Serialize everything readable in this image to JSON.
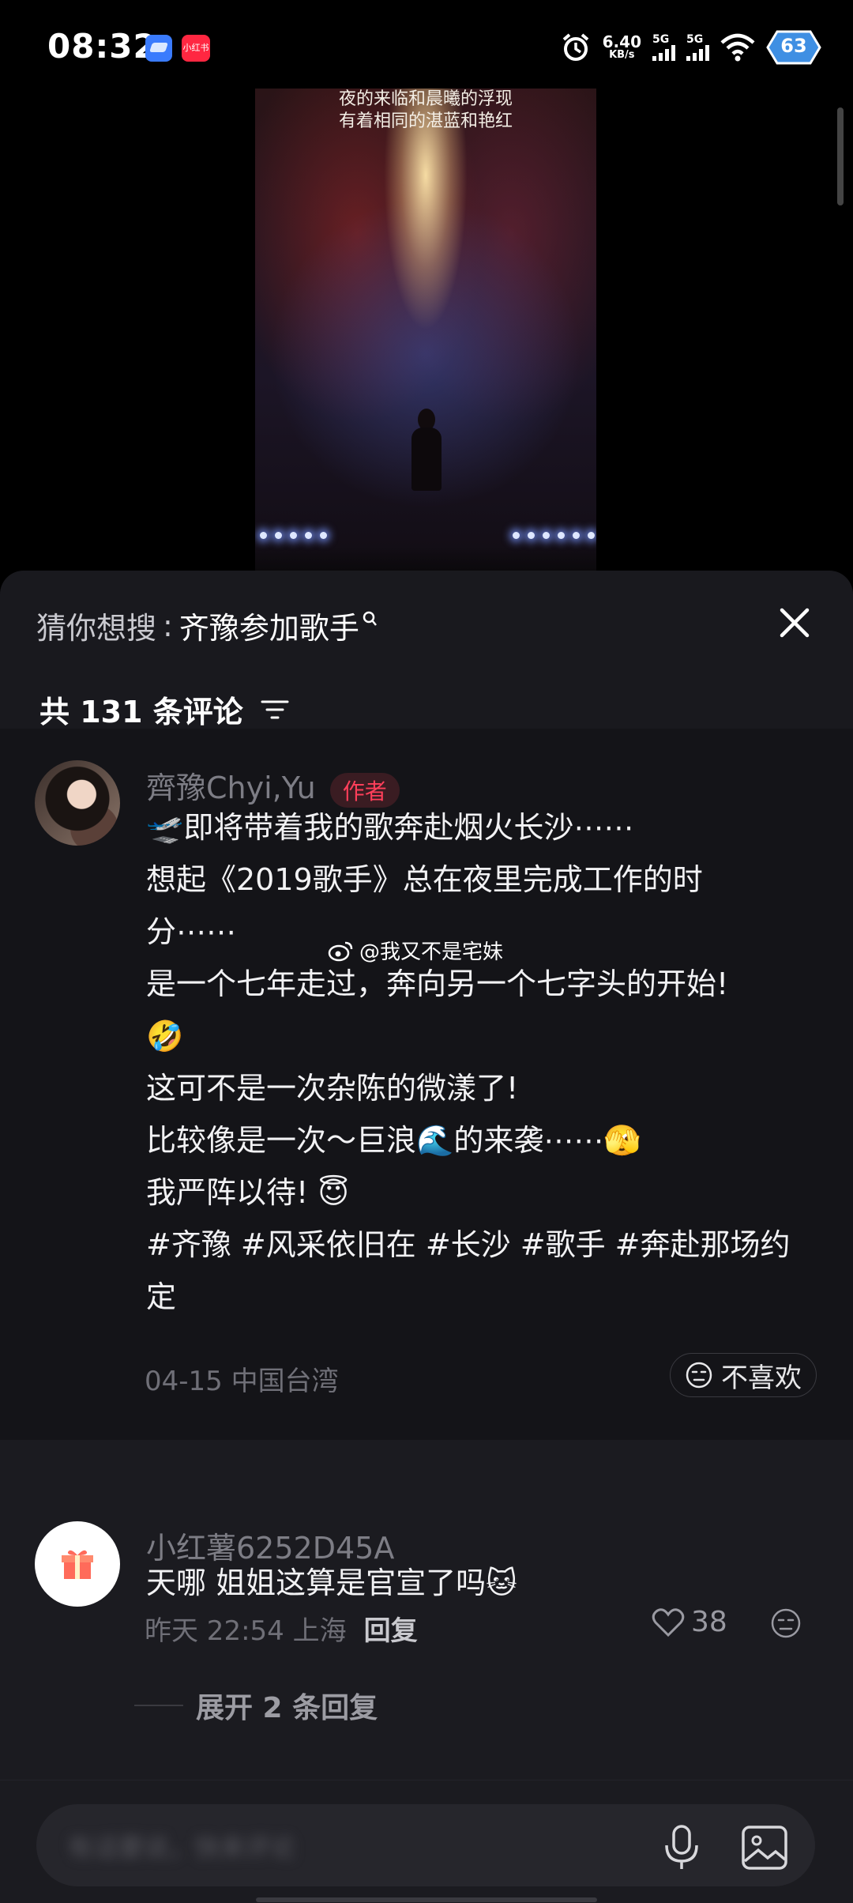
{
  "status_bar": {
    "time": "08:32",
    "app_badge": "小红书",
    "net_speed": "6.40",
    "net_unit": "KB/s",
    "signal1": "5G",
    "signal2": "5G",
    "battery": "63"
  },
  "video": {
    "caption_line1": "夜的来临和晨曦的浮现",
    "caption_line2": "有着相同的湛蓝和艳红"
  },
  "search_suggestion": {
    "prefix": "猜你想搜",
    "separator": ":",
    "query": "齐豫参加歌手"
  },
  "comments_header": {
    "count_text": "共 131 条评论"
  },
  "author_comment": {
    "name": "齊豫Chyi,Yu",
    "badge": "作者",
    "lines": [
      "🛫即将带着我的歌奔赴烟火长沙⋯⋯",
      "想起《2019歌手》总在夜里完成工作的时",
      "分⋯⋯",
      "是一个七年走过，奔向另一个七字头的开始!",
      "🤣",
      "这可不是一次杂陈的微漾了!",
      "比较像是一次～巨浪🌊的来袭⋯⋯🫣",
      "我严阵以待! 😇",
      "#齐豫 #风采依旧在 #长沙 #歌手 #奔赴那场约",
      "定"
    ],
    "watermark": "@我又不是宅妹",
    "date": "04-15",
    "location": "中国台湾",
    "dislike_label": "不喜欢"
  },
  "user_comment": {
    "name": "小红薯6252D45A",
    "text": "天哪 姐姐这算是官宣了吗🐱",
    "time": "昨天 22:54",
    "location": "上海",
    "reply_label": "回复",
    "likes": "38",
    "expand_label": "展开 2 条回复"
  },
  "input_bar": {
    "placeholder": "有话要说，快来评论"
  }
}
